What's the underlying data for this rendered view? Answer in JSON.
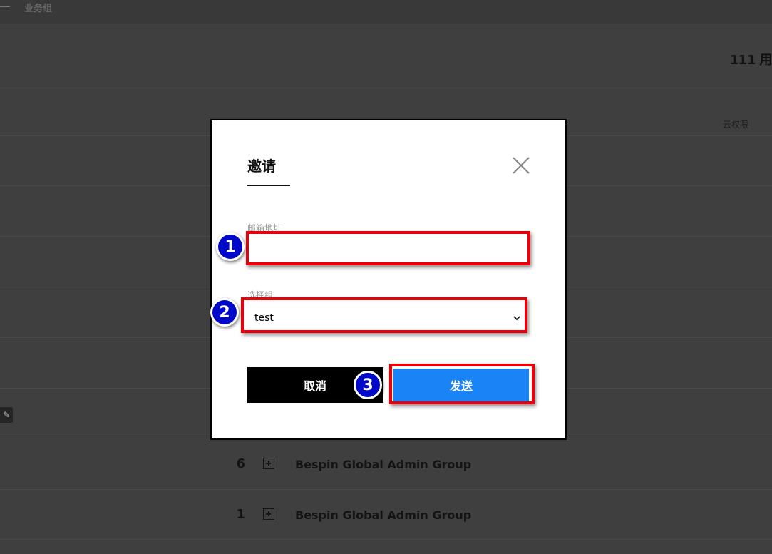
{
  "background": {
    "breadcrumb": "业务组",
    "user_count": "111 用",
    "column_header": "云权限",
    "edit_icon": "pencil-icon",
    "rows": [
      {
        "count": "6",
        "group": "Bespin Global Admin Group"
      },
      {
        "count": "1",
        "group": "Bespin Global Admin Group"
      }
    ]
  },
  "modal": {
    "title": "邀请",
    "close_icon": "close-icon",
    "email": {
      "label": "邮箱地址",
      "value": "",
      "placeholder": ""
    },
    "group": {
      "label": "选择组",
      "selected": "test"
    },
    "cancel_label": "取消",
    "send_label": "发送"
  },
  "annotations": {
    "steps": [
      "1",
      "2",
      "3"
    ],
    "badge_color": "#0008c9",
    "highlight_color": "#e8000b"
  },
  "colors": {
    "overlay": "#3f3f3f",
    "send_button": "#1a84f7",
    "cancel_button": "#000000"
  }
}
